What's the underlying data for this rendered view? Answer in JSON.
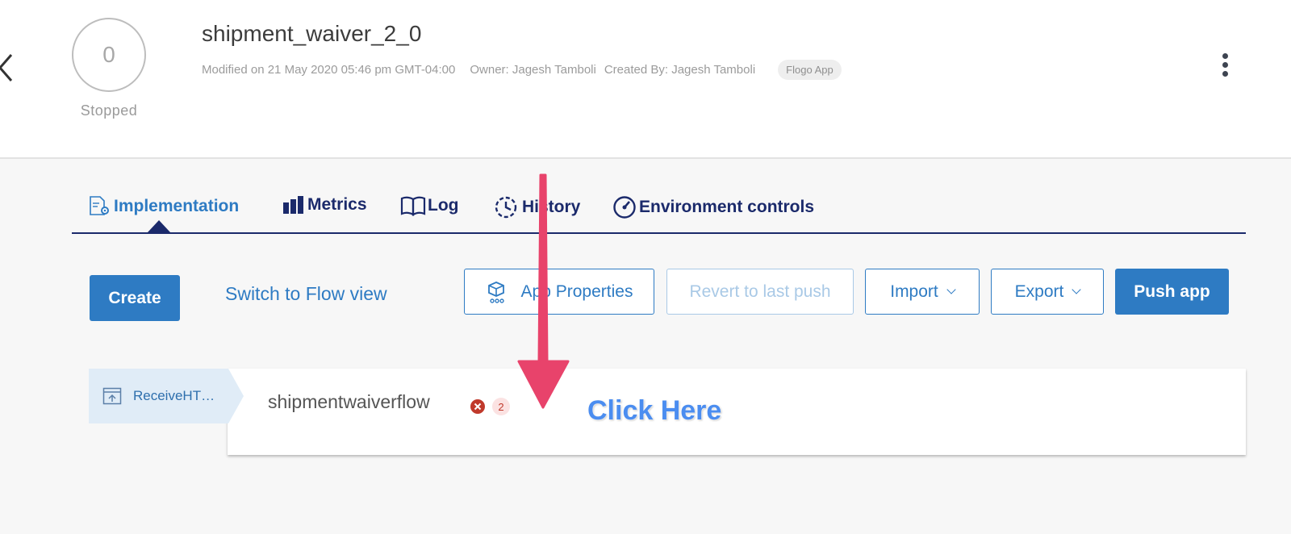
{
  "header": {
    "status_count": "0",
    "status_label": "Stopped",
    "app_title": "shipment_waiver_2_0",
    "modified": "Modified on 21 May 2020 05:46 pm GMT-04:00",
    "owner": "Owner: Jagesh Tamboli",
    "created_by": "Created By: Jagesh Tamboli",
    "app_type": "Flogo App"
  },
  "tabs": [
    {
      "label": "Implementation",
      "icon": "implementation-icon",
      "active": true
    },
    {
      "label": "Metrics",
      "icon": "bar-chart-icon",
      "active": false
    },
    {
      "label": "Log",
      "icon": "book-icon",
      "active": false
    },
    {
      "label": "History",
      "icon": "history-icon",
      "active": false
    },
    {
      "label": "Environment controls",
      "icon": "gauge-icon",
      "active": false
    }
  ],
  "toolbar": {
    "create_label": "Create",
    "switch_view_label": "Switch to Flow view",
    "app_properties_label": "App Properties",
    "revert_label": "Revert to last push",
    "import_label": "Import",
    "export_label": "Export",
    "push_label": "Push app"
  },
  "flow": {
    "trigger_label": "ReceiveHT…",
    "flow_name": "shipmentwaiverflow",
    "error_count": "2"
  },
  "annotation": {
    "text": "Click Here",
    "arrow_color": "#e8436b"
  },
  "colors": {
    "accent": "#2e7bc3",
    "tab_dark": "#1b2a6b",
    "error": "#c0392b"
  }
}
